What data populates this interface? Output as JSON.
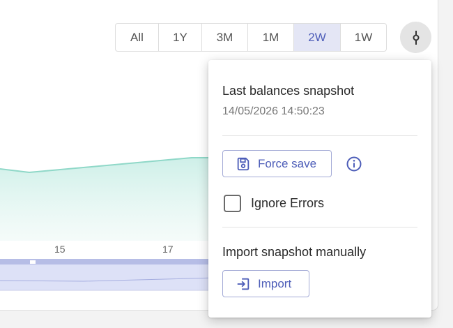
{
  "range_selector": {
    "options": [
      {
        "label": "All",
        "active": false
      },
      {
        "label": "1Y",
        "active": false
      },
      {
        "label": "3M",
        "active": false
      },
      {
        "label": "1M",
        "active": false
      },
      {
        "label": "2W",
        "active": true
      },
      {
        "label": "1W",
        "active": false
      }
    ]
  },
  "chart": {
    "x_ticks": [
      "15",
      "17"
    ],
    "line_color": "#8fd8c8",
    "navigator_color": "#c7cdf0"
  },
  "menu_toggle": {
    "icon": "commit-icon"
  },
  "popover": {
    "snapshot_title": "Last balances snapshot",
    "snapshot_time": "14/05/2026 14:50:23",
    "force_save_label": "Force save",
    "ignore_errors_label": "Ignore Errors",
    "ignore_errors_checked": false,
    "import_title": "Import snapshot manually",
    "import_label": "Import"
  },
  "colors": {
    "accent": "#4d5db8",
    "active_bg": "#e4e6f5"
  }
}
